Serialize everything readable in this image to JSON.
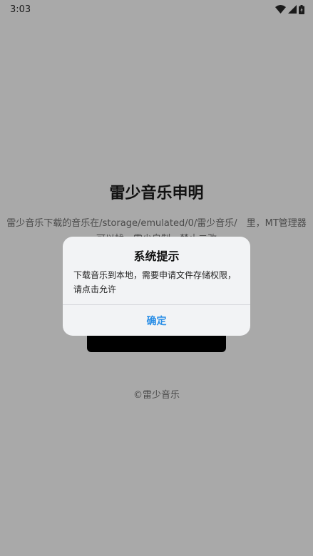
{
  "status_bar": {
    "time": "3:03"
  },
  "page": {
    "title": "雷少音乐申明",
    "description_line1": "雷少音乐下载的音乐在/storage/emulated/0/雷少音乐/　里，MT管理器",
    "description_line2": "可以找，雷少自制，禁止二改",
    "footer": "©雷少音乐"
  },
  "dialog": {
    "title": "系统提示",
    "message": "下载音乐到本地，需要申请文件存储权限，请点击允许",
    "confirm_label": "确定"
  },
  "colors": {
    "overlay_background": "#a9a9a9",
    "dialog_background": "#f2f3f5",
    "accent": "#2a8ee6"
  }
}
